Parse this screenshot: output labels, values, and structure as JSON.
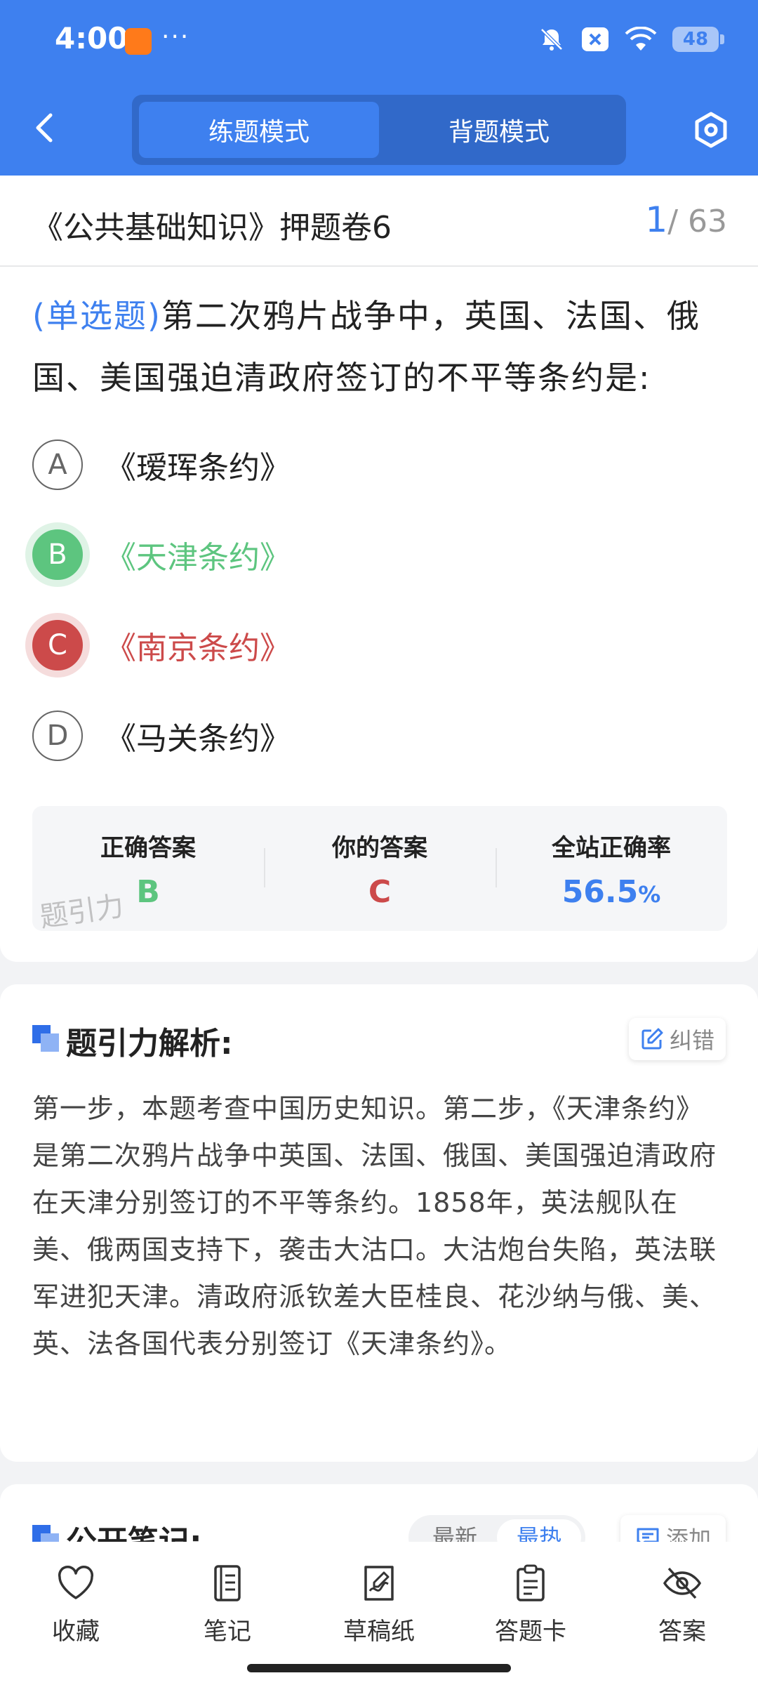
{
  "status_bar": {
    "time": "4:00",
    "more": "···",
    "battery": "48"
  },
  "header": {
    "modes": [
      "练题模式",
      "背题模式"
    ],
    "active_mode": 0
  },
  "paper": {
    "title": "《公共基础知识》押题卷6",
    "current": "1",
    "total": "/ 63"
  },
  "question": {
    "type": "(单选题)",
    "text": "第二次鸦片战争中，英国、法国、俄国、美国强迫清政府签订的不平等条约是:",
    "options": [
      {
        "letter": "A",
        "text": "《瑷珲条约》",
        "state": "normal"
      },
      {
        "letter": "B",
        "text": "《天津条约》",
        "state": "correct"
      },
      {
        "letter": "C",
        "text": "《南京条约》",
        "state": "wrong"
      },
      {
        "letter": "D",
        "text": "《马关条约》",
        "state": "normal"
      }
    ]
  },
  "result": {
    "correct_label": "正确答案",
    "correct_value": "B",
    "yours_label": "你的答案",
    "yours_value": "C",
    "rate_label": "全站正确率",
    "rate_value": "56.5",
    "rate_unit": "%",
    "watermark": "题引力"
  },
  "analysis": {
    "title": "题引力解析:",
    "fix_label": "纠错",
    "text": "第一步，本题考查中国历史知识。第二步，《天津条约》是第二次鸦片战争中英国、法国、俄国、美国强迫清政府在天津分别签订的不平等条约。1858年，英法舰队在美、俄两国支持下，袭击大沽口。大沽炮台失陷，英法联军进犯天津。清政府派钦差大臣桂良、花沙纳与俄、美、英、法各国代表分别签订《天津条约》。"
  },
  "notes": {
    "title": "公开笔记:",
    "sort_new": "最新",
    "sort_hot": "最热",
    "add_label": "添加"
  },
  "bottom_nav": [
    {
      "label": "收藏",
      "icon": "heart-icon"
    },
    {
      "label": "笔记",
      "icon": "notebook-icon"
    },
    {
      "label": "草稿纸",
      "icon": "draft-icon"
    },
    {
      "label": "答题卡",
      "icon": "clipboard-icon"
    },
    {
      "label": "答案",
      "icon": "eye-off-icon"
    }
  ],
  "colors": {
    "primary": "#3e80ef",
    "correct": "#5dc57f",
    "wrong": "#cc4a4a"
  }
}
